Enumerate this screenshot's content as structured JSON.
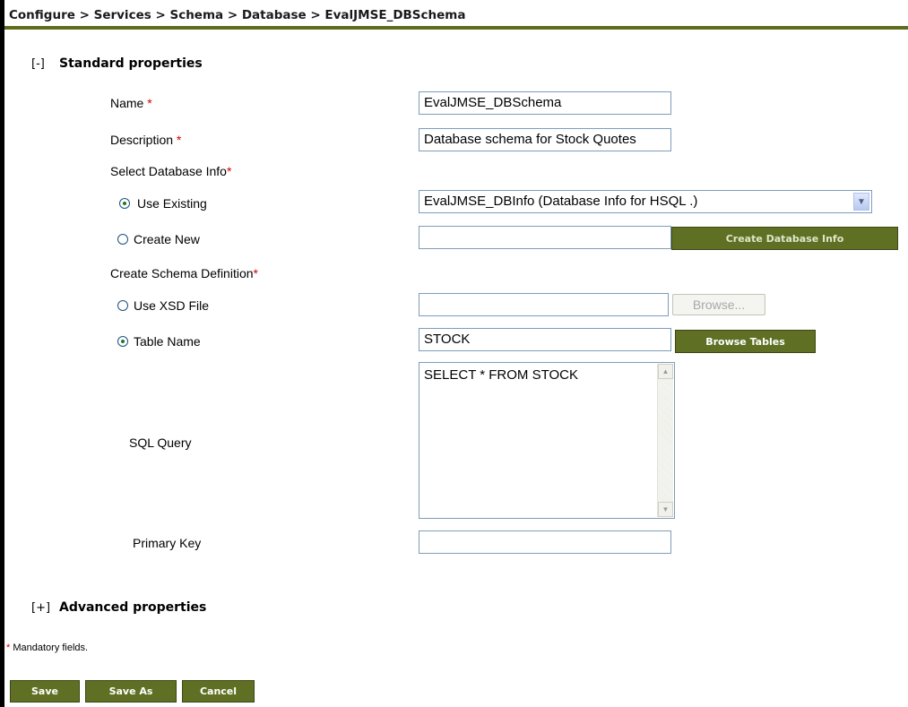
{
  "breadcrumb": "Configure > Services > Schema > Database > EvalJMSE_DBSchema",
  "standard_section": {
    "toggle": "[-]",
    "title": "Standard properties"
  },
  "fields": {
    "name": {
      "label": "Name",
      "value": "EvalJMSE_DBSchema"
    },
    "description": {
      "label": "Description",
      "value": "Database schema for Stock Quotes"
    },
    "select_db_info_label": "Select Database Info",
    "use_existing": {
      "label": "Use Existing",
      "selected_option": "EvalJMSE_DBInfo (Database Info for HSQL .)"
    },
    "create_new": {
      "label": "Create New",
      "value": "",
      "button": "Create Database Info"
    },
    "create_schema_label": "Create Schema Definition",
    "use_xsd": {
      "label": "Use XSD File",
      "value": "",
      "button": "Browse..."
    },
    "table_name": {
      "label": "Table Name",
      "value": "STOCK",
      "button": "Browse Tables"
    },
    "sql_query": {
      "label": "SQL Query",
      "value": "SELECT * FROM STOCK"
    },
    "primary_key": {
      "label": "Primary Key",
      "value": ""
    }
  },
  "required_marker": "*",
  "advanced_section": {
    "toggle": "[+]",
    "title": "Advanced properties"
  },
  "mandatory_note": "Mandatory fields.",
  "actions": {
    "save": "Save",
    "save_as": "Save As",
    "cancel": "Cancel"
  },
  "colors": {
    "accent": "#5f7024",
    "header_rule": "#5f6b1d",
    "required": "#d40000"
  }
}
